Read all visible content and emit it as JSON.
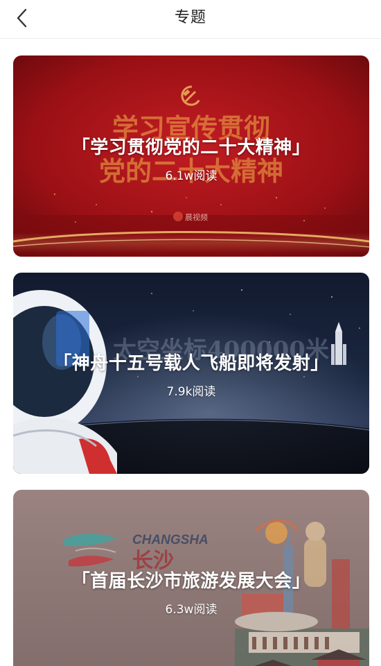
{
  "header": {
    "title": "专题",
    "back_icon": "chevron-left-icon"
  },
  "topics": [
    {
      "title": "「学习贯彻党的二十大精神」",
      "reads": "6.1w阅读",
      "bg_line1": "学习宣传贯彻",
      "bg_line2": "党的二十大精神",
      "bg_watermark": "晨视频",
      "colors": {
        "primary": "#b3141b",
        "dark": "#7a0c10",
        "gold": "#f5c26b"
      }
    },
    {
      "title": "「神舟十五号载人飞船即将发射」",
      "reads": "7.9k阅读",
      "bg_text": "太空坐标400000米",
      "colors": {
        "space": "#0d1220",
        "sky": "#1e2a44"
      }
    },
    {
      "title": "「首届长沙市旅游发展大会」",
      "reads": "6.3w阅读",
      "bg_logo_en": "CHANGSHA",
      "bg_logo_cn": "长沙",
      "colors": {
        "base": "#8d7674",
        "red": "#c7353b",
        "teal": "#3aa7a2"
      }
    }
  ]
}
